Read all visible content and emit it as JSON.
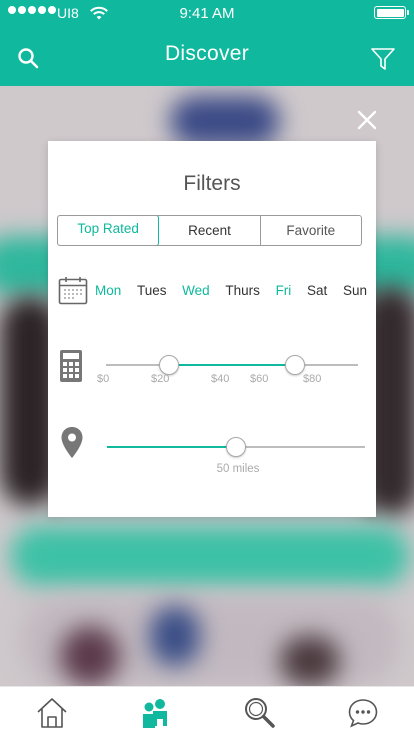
{
  "status_bar": {
    "carrier": "UI8",
    "time": "9:41 AM"
  },
  "nav": {
    "title": "Discover",
    "left_icon": "search-icon",
    "right_icon": "filter-icon"
  },
  "filters": {
    "title": "Filters",
    "segments": [
      {
        "label": "Top Rated",
        "active": true
      },
      {
        "label": "Recent",
        "active": false
      },
      {
        "label": "Favorite",
        "active": false
      }
    ],
    "days": [
      {
        "label": "Mon",
        "selected": true
      },
      {
        "label": "Tues",
        "selected": false
      },
      {
        "label": "Wed",
        "selected": true
      },
      {
        "label": "Thurs",
        "selected": false
      },
      {
        "label": "Fri",
        "selected": true
      },
      {
        "label": "Sat",
        "selected": false
      },
      {
        "label": "Sun",
        "selected": false
      }
    ],
    "price": {
      "ticks": [
        "$0",
        "$20",
        "$40",
        "$60",
        "$80"
      ],
      "range_low": 25,
      "range_high": 75
    },
    "distance": {
      "label": "50 miles",
      "value": 50
    }
  },
  "tabbar": {
    "items": [
      "home-icon",
      "people-icon",
      "search-icon",
      "chat-icon"
    ],
    "active": "people-icon"
  },
  "colors": {
    "accent": "#10b99d",
    "inactive": "#333333"
  }
}
